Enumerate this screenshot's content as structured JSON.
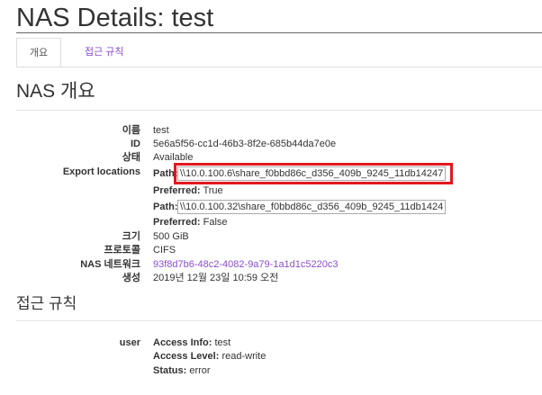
{
  "header": {
    "title": "NAS Details: test"
  },
  "tabs": [
    {
      "label": "개요",
      "active": true
    },
    {
      "label": "접근 규칙",
      "active": false
    }
  ],
  "overview": {
    "title": "NAS 개요",
    "name_label": "이름",
    "name": "test",
    "id_label": "ID",
    "id": "5e6a5f56-cc1d-46b3-8f2e-685b44da7e0e",
    "status_label": "상태",
    "status": "Available",
    "export_label": "Export locations",
    "exports": [
      {
        "path_label": "Path:",
        "path": "\\\\10.0.100.6\\share_f0bbd86c_d356_409b_9245_11db14247",
        "preferred_label": "Preferred:",
        "preferred": "True"
      },
      {
        "path_label": "Path:",
        "path": "\\\\10.0.100.32\\share_f0bbd86c_d356_409b_9245_11db1424",
        "preferred_label": "Preferred:",
        "preferred": "False"
      }
    ],
    "size_label": "크기",
    "size": "500 GiB",
    "protocol_label": "프로토콜",
    "protocol": "CIFS",
    "network_label": "NAS 네트워크",
    "network": "93f8d7b6-48c2-4082-9a79-1a1d1c5220c3",
    "created_label": "생성",
    "created": "2019년 12월 23일 10:59 오전"
  },
  "access_rules": {
    "title": "접근 규칙",
    "user_label": "user",
    "access_info_label": "Access Info:",
    "access_info": "test",
    "access_level_label": "Access Level:",
    "access_level": "read-write",
    "status_label": "Status:",
    "status": "error"
  },
  "colors": {
    "link": "#8a4fcf",
    "highlight": "#e0191e"
  }
}
